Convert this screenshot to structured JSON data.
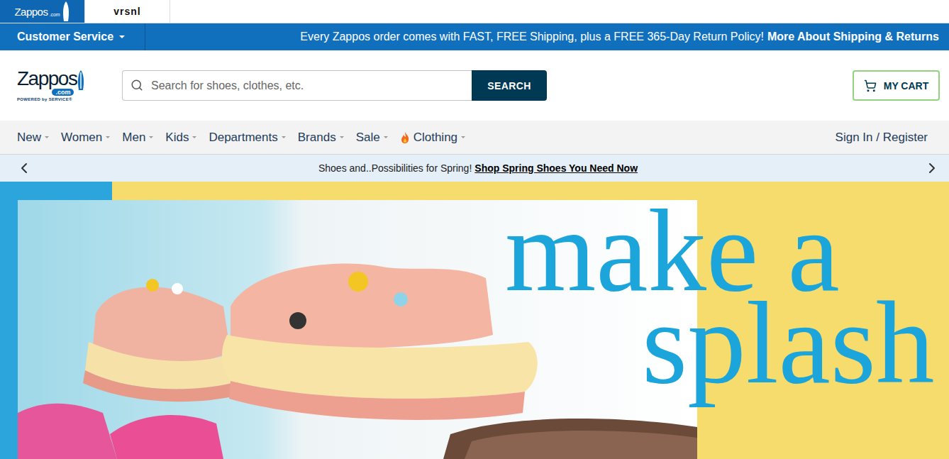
{
  "brandTabs": [
    {
      "label": "Zappos",
      "sub": ".com",
      "selected": true
    },
    {
      "label": "vrsnl",
      "selected": false
    }
  ],
  "topBar": {
    "menu": "Customer Service",
    "message": "Every Zappos order comes with FAST, FREE Shipping, plus a FREE 365-Day Return Policy!",
    "link": "More About Shipping & Returns"
  },
  "logo": {
    "name": "Zappos",
    "domain": ".com",
    "tagline": "POWERED by SERVICE®"
  },
  "search": {
    "placeholder": "Search for shoes, clothes, etc.",
    "button": "SEARCH"
  },
  "cart": {
    "label": "MY CART"
  },
  "nav": {
    "items": [
      {
        "label": "New",
        "hot": false
      },
      {
        "label": "Women",
        "hot": false
      },
      {
        "label": "Men",
        "hot": false
      },
      {
        "label": "Kids",
        "hot": false
      },
      {
        "label": "Departments",
        "hot": false
      },
      {
        "label": "Brands",
        "hot": false
      },
      {
        "label": "Sale",
        "hot": false
      },
      {
        "label": "Clothing",
        "hot": true
      }
    ],
    "account": "Sign In / Register"
  },
  "promo": {
    "text": "Shoes and..Possibilities for Spring!",
    "link": "Shop Spring Shoes You Need Now"
  },
  "hero": {
    "headline": [
      "make a",
      "splash"
    ]
  }
}
